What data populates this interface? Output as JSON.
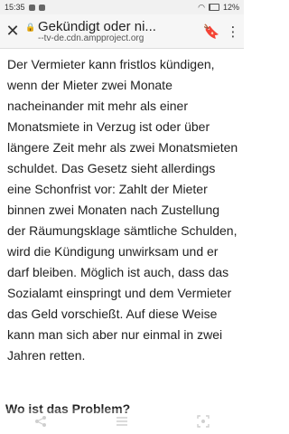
{
  "status": {
    "time": "15:35",
    "battery": "12%"
  },
  "browser": {
    "title": "Gekündigt oder ni...",
    "url": "--tv-de.cdn.ampproject.org",
    "close_glyph": "✕",
    "bookmark_glyph": "🔖",
    "menu_glyph": "⋮"
  },
  "article": {
    "paragraph": "Der Vermieter kann fristlos kündigen, wenn der Mieter zwei Monate nacheinander mit mehr als einer Monatsmiete in Verzug ist oder über längere Zeit mehr als zwei Monatsmieten schuldet. Das Gesetz sieht allerdings eine Schonfrist vor: Zahlt der Mieter binnen zwei Monaten nach Zustellung der Räumungsklage sämtliche Schulden, wird die Kündigung unwirksam und er darf bleiben. Möglich ist auch, dass das Sozialamt einspringt und dem Vermieter das Geld vorschießt. Auf diese Weise kann man sich aber nur einmal in zwei Jahren retten.",
    "heading": "Wo ist das Problem?"
  },
  "icons": {
    "share": "share-icon",
    "list": "list-icon",
    "scan": "scan-icon"
  }
}
